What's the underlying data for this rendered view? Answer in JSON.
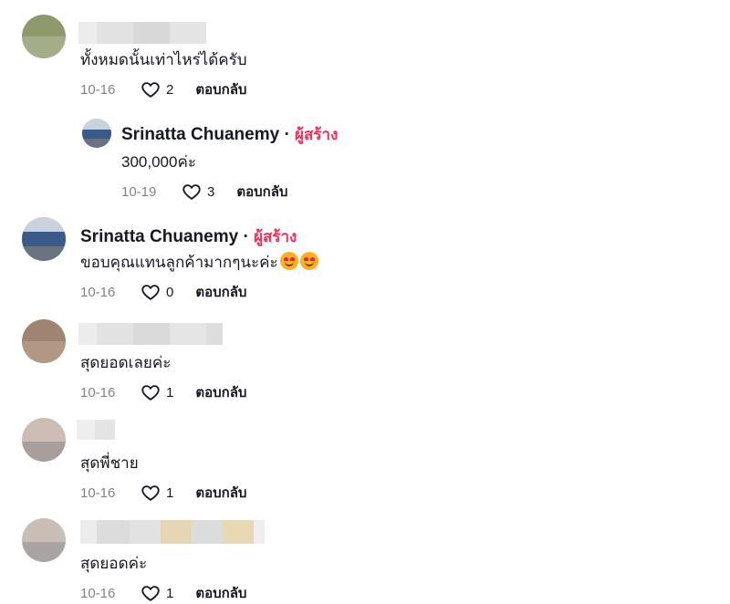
{
  "comments": [
    {
      "text": "ทั้งหมดนั้นเท่าไหร่ได้ครับ",
      "date": "10-16",
      "likes": "2",
      "reply_label": "ตอบกลับ",
      "replies": [
        {
          "author": "Srinatta Chuanemy",
          "separator": "·",
          "badge": "ผู้สร้าง",
          "text": "300,000ค่ะ",
          "date": "10-19",
          "likes": "3",
          "reply_label": "ตอบกลับ"
        }
      ]
    },
    {
      "author": "Srinatta Chuanemy",
      "separator": "·",
      "badge": "ผู้สร้าง",
      "text": "ขอบคุณแทนลูกค้ามากๆนะค่ะ",
      "emojis": [
        "smiling-face-with-heart-eyes",
        "smiling-face-with-heart-eyes"
      ],
      "date": "10-16",
      "likes": "0",
      "reply_label": "ตอบกลับ"
    },
    {
      "text": "สุดยอดเลยค่ะ",
      "date": "10-16",
      "likes": "1",
      "reply_label": "ตอบกลับ"
    },
    {
      "text": "สุดพี่ชาย",
      "date": "10-16",
      "likes": "1",
      "reply_label": "ตอบกลับ"
    },
    {
      "text": "สุดยอดค่ะ",
      "date": "10-16",
      "likes": "1",
      "reply_label": "ตอบกลับ"
    }
  ],
  "colors": {
    "creator_badge": "#fe2c55",
    "text": "#161823",
    "muted": "#8a8b91"
  }
}
